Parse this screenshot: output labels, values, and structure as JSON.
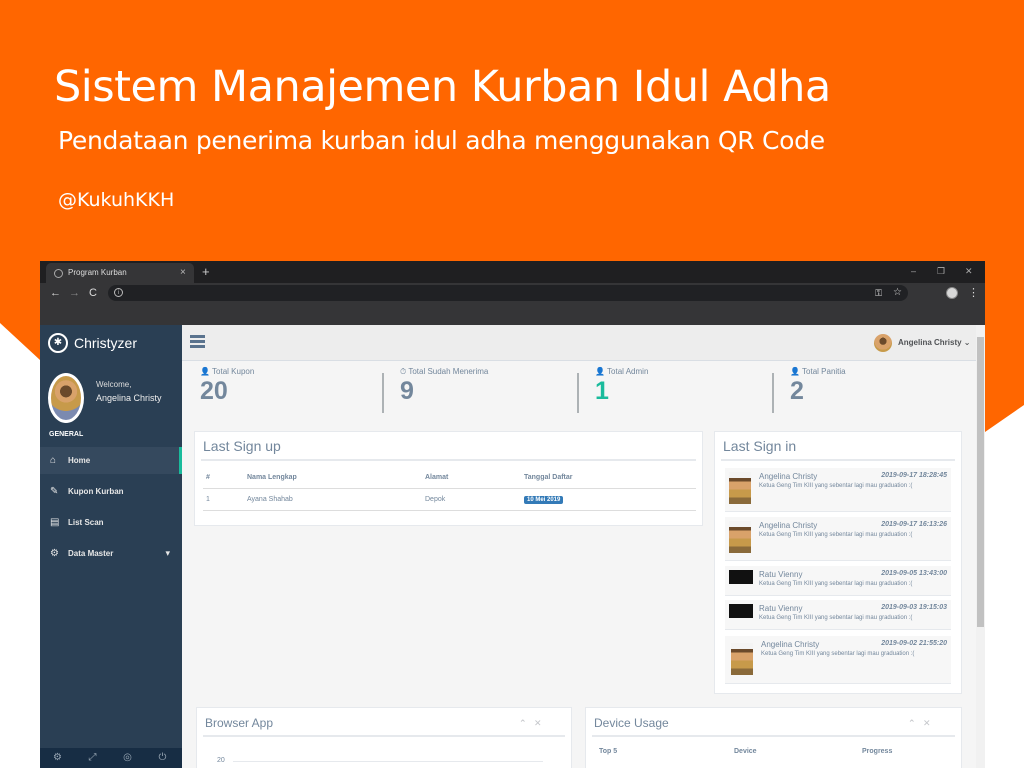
{
  "hero": {
    "title": "Sistem Manajemen Kurban Idul Adha",
    "subtitle": "Pendataan penerima kurban idul adha menggunakan QR Code",
    "author": "@KukuhKKH",
    "background_color": "#ff6600"
  },
  "browser": {
    "tab_title": "Program Kurban",
    "tab_close": "×",
    "new_tab": "+",
    "back": "←",
    "forward": "→",
    "reload": "C",
    "url_info": "i",
    "key_icon": "⚿",
    "star_icon": "☆",
    "menu": "⋮",
    "win_minimize": "–",
    "win_restore": "❐",
    "win_close": "✕"
  },
  "app": {
    "brand": "Christyzer",
    "brand_icon": "bug-icon",
    "welcome_label": "Welcome,",
    "welcome_name": "Angelina Christy",
    "menu_section": "GENERAL",
    "menu": [
      {
        "label": "Home",
        "icon": "⌂",
        "active": true
      },
      {
        "label": "Kupon Kurban",
        "icon": "✎"
      },
      {
        "label": "List Scan",
        "icon": "▤"
      },
      {
        "label": "Data Master",
        "icon": "⚙",
        "chevron": "▾"
      }
    ],
    "footer_icons": [
      "⚙",
      "⤢",
      "◎",
      "⏻"
    ],
    "user": "Angelina Christy ⌄",
    "accent_color": "#1abb9c",
    "sidebar_color": "#2a3f54"
  },
  "tiles": [
    {
      "label": "👤 Total Kupon",
      "value": "20"
    },
    {
      "label": "⏱ Total Sudah Menerima",
      "value": "9"
    },
    {
      "label": "👤 Total Admin",
      "value": "1",
      "green": true
    },
    {
      "label": "👤 Total Panitia",
      "value": "2"
    }
  ],
  "last_signup": {
    "title": "Last Sign up",
    "headers": [
      "#",
      "Nama Lengkap",
      "Alamat",
      "Tanggal Daftar"
    ],
    "rows": [
      {
        "no": "1",
        "name": "Ayana Shahab",
        "address": "Depok",
        "date": "10 Mei 2019"
      }
    ]
  },
  "last_signin": {
    "title": "Last Sign in",
    "items": [
      {
        "name": "Angelina Christy",
        "time": "2019-09-17 18:28:45",
        "message": "Ketua Geng Tim KIII yang sebentar lagi mau graduation :(",
        "avatar": "photo"
      },
      {
        "name": "Angelina Christy",
        "time": "2019-09-17 16:13:26",
        "message": "Ketua Geng Tim KIII yang sebentar lagi mau graduation :(",
        "avatar": "photo"
      },
      {
        "name": "Ratu Vienny",
        "time": "2019-09-05 13:43:00",
        "message": "Ketua Geng Tim KIII yang sebentar lagi mau graduation :(",
        "avatar": "dark"
      },
      {
        "name": "Ratu Vienny",
        "time": "2019-09-03 19:15:03",
        "message": "Ketua Geng Tim KIII yang sebentar lagi mau graduation :(",
        "avatar": "dark"
      },
      {
        "name": "Angelina Christy",
        "time": "2019-09-02 21:55:20",
        "message": "Ketua Geng Tim KIII yang sebentar lagi mau graduation :(",
        "avatar": "photo"
      }
    ]
  },
  "browser_app": {
    "title": "Browser App",
    "collapse": "⌃",
    "close": "✕",
    "y_tick": "20"
  },
  "device_usage": {
    "title": "Device Usage",
    "collapse": "⌃",
    "close": "✕",
    "headers": [
      "Top 5",
      "Device",
      "Progress"
    ]
  }
}
